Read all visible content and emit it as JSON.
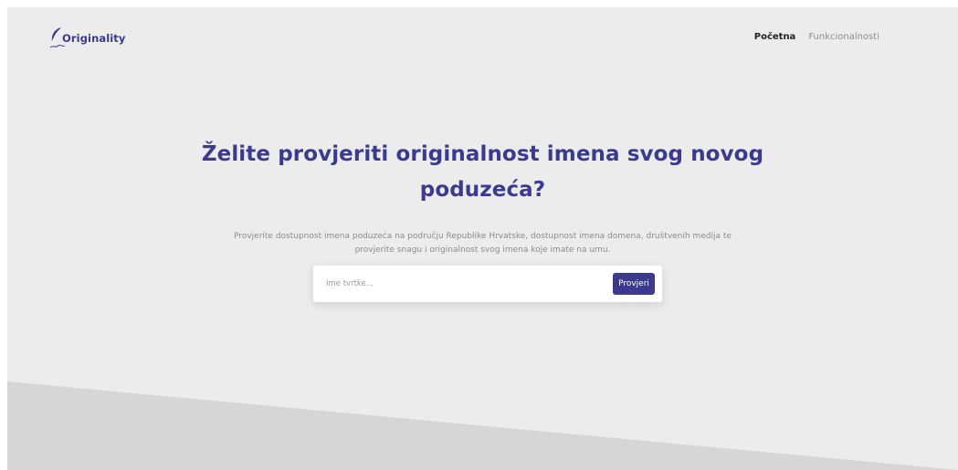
{
  "brand": {
    "name": "Originality",
    "accent_color": "#3b3a8f"
  },
  "nav": {
    "items": [
      {
        "label": "Početna",
        "active": true
      },
      {
        "label": "Funkcionalnosti",
        "active": false
      }
    ]
  },
  "hero": {
    "title": "Želite provjeriti originalnost imena svog novog poduzeća?",
    "subtitle": "Provjerite dostupnost imena poduzeća na području Republike Hrvatske, dostupnost imena domena, društvenih medija te provjerite snagu i originalnost svog imena koje imate na umu."
  },
  "search": {
    "placeholder": "Ime tvrtke...",
    "value": "",
    "button_label": "Provjeri"
  },
  "colors": {
    "background": "#ececec",
    "footer_band": "#d5d5d5",
    "nav_active": "#222222",
    "nav_inactive": "#8d8d8d",
    "subtitle": "#8b8b8b"
  }
}
